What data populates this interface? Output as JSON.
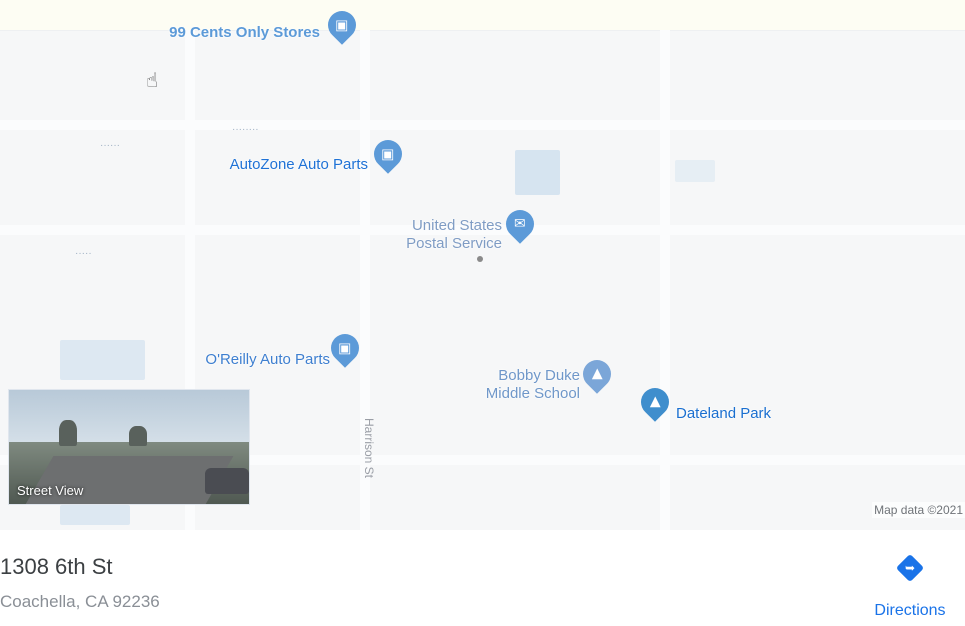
{
  "colors": {
    "accent": "#1a73e8",
    "pin_blue": "#5c9ad8",
    "pin_green": "#3f8ecd",
    "label_blue": "#1967d2",
    "school_blue": "#6f97c9"
  },
  "map": {
    "places": [
      {
        "id": "99cents",
        "name": "99 Cents Only Stores",
        "icon": "shopping-bag-icon"
      },
      {
        "id": "autozone",
        "name": "AutoZone Auto Parts",
        "icon": "shopping-bag-icon"
      },
      {
        "id": "usps",
        "name": "United States Postal Service",
        "line1": "United States",
        "line2": "Postal Service",
        "icon": "mail-icon"
      },
      {
        "id": "oreilly",
        "name": "O'Reilly Auto Parts",
        "icon": "shopping-bag-icon"
      },
      {
        "id": "bobbyduke",
        "name": "Bobby Duke Middle School",
        "line1": "Bobby Duke",
        "line2": "Middle School",
        "icon": "school-icon"
      },
      {
        "id": "dateland",
        "name": "Dateland Park",
        "icon": "tree-icon"
      }
    ],
    "street_label": "Harrison St",
    "street_view_label": "Street View",
    "attribution": "Map data ©2021"
  },
  "address": {
    "line1": "1308 6th St",
    "line2": "Coachella, CA 92236"
  },
  "directions": {
    "label": "Directions",
    "icon": "directions-icon"
  }
}
